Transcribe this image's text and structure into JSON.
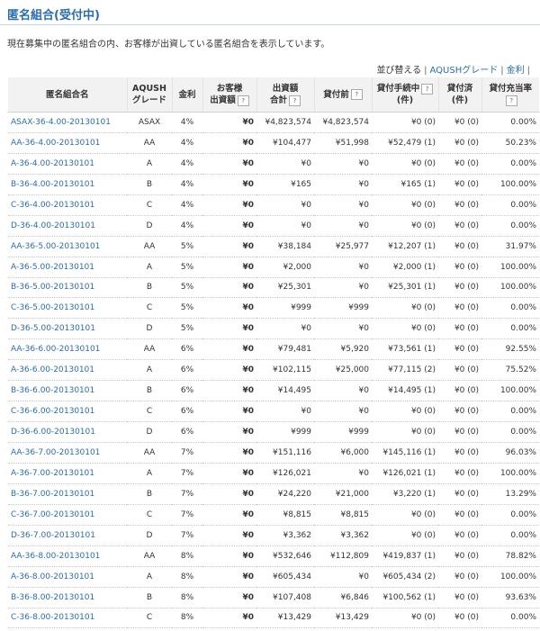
{
  "page": {
    "title": "匿名組合(受付中)",
    "intro": "現在募集中の匿名組合の内、お客様が出資している匿名組合を表示しています。"
  },
  "sort": {
    "label": "並び替える",
    "options": [
      "AQUSHグレード",
      "金利"
    ]
  },
  "columns": {
    "name": "匿名組合名",
    "grade_line1": "AQUSH",
    "grade_line2": "グレード",
    "rate": "金利",
    "mine_line1": "お客様",
    "mine_line2": "出資額",
    "total_line1": "出資額",
    "total_line2": "合計",
    "before": "貸付前",
    "pending_line1": "貸付手続中",
    "pending_line2": "(件)",
    "done_line1": "貸付済",
    "done_line2": "(件)",
    "ratio": "貸付充当率",
    "help_icon": "?"
  },
  "rows": [
    {
      "name": "ASAX-36-4.00-20130101",
      "grade": "ASAX",
      "rate": "4%",
      "mine": "¥0",
      "total": "¥4,823,574",
      "before": "¥4,823,574",
      "pending": "¥0 (0)",
      "done": "¥0 (0)",
      "ratio": "0.00%"
    },
    {
      "name": "AA-36-4.00-20130101",
      "grade": "AA",
      "rate": "4%",
      "mine": "¥0",
      "total": "¥104,477",
      "before": "¥51,998",
      "pending": "¥52,479 (1)",
      "done": "¥0 (0)",
      "ratio": "50.23%"
    },
    {
      "name": "A-36-4.00-20130101",
      "grade": "A",
      "rate": "4%",
      "mine": "¥0",
      "total": "¥0",
      "before": "¥0",
      "pending": "¥0 (0)",
      "done": "¥0 (0)",
      "ratio": "0.00%"
    },
    {
      "name": "B-36-4.00-20130101",
      "grade": "B",
      "rate": "4%",
      "mine": "¥0",
      "total": "¥165",
      "before": "¥0",
      "pending": "¥165 (1)",
      "done": "¥0 (0)",
      "ratio": "100.00%"
    },
    {
      "name": "C-36-4.00-20130101",
      "grade": "C",
      "rate": "4%",
      "mine": "¥0",
      "total": "¥0",
      "before": "¥0",
      "pending": "¥0 (0)",
      "done": "¥0 (0)",
      "ratio": "0.00%"
    },
    {
      "name": "D-36-4.00-20130101",
      "grade": "D",
      "rate": "4%",
      "mine": "¥0",
      "total": "¥0",
      "before": "¥0",
      "pending": "¥0 (0)",
      "done": "¥0 (0)",
      "ratio": "0.00%"
    },
    {
      "name": "AA-36-5.00-20130101",
      "grade": "AA",
      "rate": "5%",
      "mine": "¥0",
      "total": "¥38,184",
      "before": "¥25,977",
      "pending": "¥12,207 (1)",
      "done": "¥0 (0)",
      "ratio": "31.97%"
    },
    {
      "name": "A-36-5.00-20130101",
      "grade": "A",
      "rate": "5%",
      "mine": "¥0",
      "total": "¥2,000",
      "before": "¥0",
      "pending": "¥2,000 (1)",
      "done": "¥0 (0)",
      "ratio": "100.00%"
    },
    {
      "name": "B-36-5.00-20130101",
      "grade": "B",
      "rate": "5%",
      "mine": "¥0",
      "total": "¥25,301",
      "before": "¥0",
      "pending": "¥25,301 (1)",
      "done": "¥0 (0)",
      "ratio": "100.00%"
    },
    {
      "name": "C-36-5.00-20130101",
      "grade": "C",
      "rate": "5%",
      "mine": "¥0",
      "total": "¥999",
      "before": "¥999",
      "pending": "¥0 (0)",
      "done": "¥0 (0)",
      "ratio": "0.00%"
    },
    {
      "name": "D-36-5.00-20130101",
      "grade": "D",
      "rate": "5%",
      "mine": "¥0",
      "total": "¥0",
      "before": "¥0",
      "pending": "¥0 (0)",
      "done": "¥0 (0)",
      "ratio": "0.00%"
    },
    {
      "name": "AA-36-6.00-20130101",
      "grade": "AA",
      "rate": "6%",
      "mine": "¥0",
      "total": "¥79,481",
      "before": "¥5,920",
      "pending": "¥73,561 (1)",
      "done": "¥0 (0)",
      "ratio": "92.55%"
    },
    {
      "name": "A-36-6.00-20130101",
      "grade": "A",
      "rate": "6%",
      "mine": "¥0",
      "total": "¥102,115",
      "before": "¥25,000",
      "pending": "¥77,115 (2)",
      "done": "¥0 (0)",
      "ratio": "75.52%"
    },
    {
      "name": "B-36-6.00-20130101",
      "grade": "B",
      "rate": "6%",
      "mine": "¥0",
      "total": "¥14,495",
      "before": "¥0",
      "pending": "¥14,495 (1)",
      "done": "¥0 (0)",
      "ratio": "100.00%"
    },
    {
      "name": "C-36-6.00-20130101",
      "grade": "C",
      "rate": "6%",
      "mine": "¥0",
      "total": "¥0",
      "before": "¥0",
      "pending": "¥0 (0)",
      "done": "¥0 (0)",
      "ratio": "0.00%"
    },
    {
      "name": "D-36-6.00-20130101",
      "grade": "D",
      "rate": "6%",
      "mine": "¥0",
      "total": "¥999",
      "before": "¥999",
      "pending": "¥0 (0)",
      "done": "¥0 (0)",
      "ratio": "0.00%"
    },
    {
      "name": "AA-36-7.00-20130101",
      "grade": "AA",
      "rate": "7%",
      "mine": "¥0",
      "total": "¥151,116",
      "before": "¥6,000",
      "pending": "¥145,116 (1)",
      "done": "¥0 (0)",
      "ratio": "96.03%"
    },
    {
      "name": "A-36-7.00-20130101",
      "grade": "A",
      "rate": "7%",
      "mine": "¥0",
      "total": "¥126,021",
      "before": "¥0",
      "pending": "¥126,021 (1)",
      "done": "¥0 (0)",
      "ratio": "100.00%"
    },
    {
      "name": "B-36-7.00-20130101",
      "grade": "B",
      "rate": "7%",
      "mine": "¥0",
      "total": "¥24,220",
      "before": "¥21,000",
      "pending": "¥3,220 (1)",
      "done": "¥0 (0)",
      "ratio": "13.29%"
    },
    {
      "name": "C-36-7.00-20130101",
      "grade": "C",
      "rate": "7%",
      "mine": "¥0",
      "total": "¥8,815",
      "before": "¥8,815",
      "pending": "¥0 (0)",
      "done": "¥0 (0)",
      "ratio": "0.00%"
    },
    {
      "name": "D-36-7.00-20130101",
      "grade": "D",
      "rate": "7%",
      "mine": "¥0",
      "total": "¥3,362",
      "before": "¥3,362",
      "pending": "¥0 (0)",
      "done": "¥0 (0)",
      "ratio": "0.00%"
    },
    {
      "name": "AA-36-8.00-20130101",
      "grade": "AA",
      "rate": "8%",
      "mine": "¥0",
      "total": "¥532,646",
      "before": "¥112,809",
      "pending": "¥419,837 (1)",
      "done": "¥0 (0)",
      "ratio": "78.82%"
    },
    {
      "name": "A-36-8.00-20130101",
      "grade": "A",
      "rate": "8%",
      "mine": "¥0",
      "total": "¥605,434",
      "before": "¥0",
      "pending": "¥605,434 (2)",
      "done": "¥0 (0)",
      "ratio": "100.00%"
    },
    {
      "name": "B-36-8.00-20130101",
      "grade": "B",
      "rate": "8%",
      "mine": "¥0",
      "total": "¥107,408",
      "before": "¥6,846",
      "pending": "¥100,562 (1)",
      "done": "¥0 (0)",
      "ratio": "93.63%"
    },
    {
      "name": "C-36-8.00-20130101",
      "grade": "C",
      "rate": "8%",
      "mine": "¥0",
      "total": "¥13,429",
      "before": "¥13,429",
      "pending": "¥0 (0)",
      "done": "¥0 (0)",
      "ratio": "0.00%"
    }
  ]
}
